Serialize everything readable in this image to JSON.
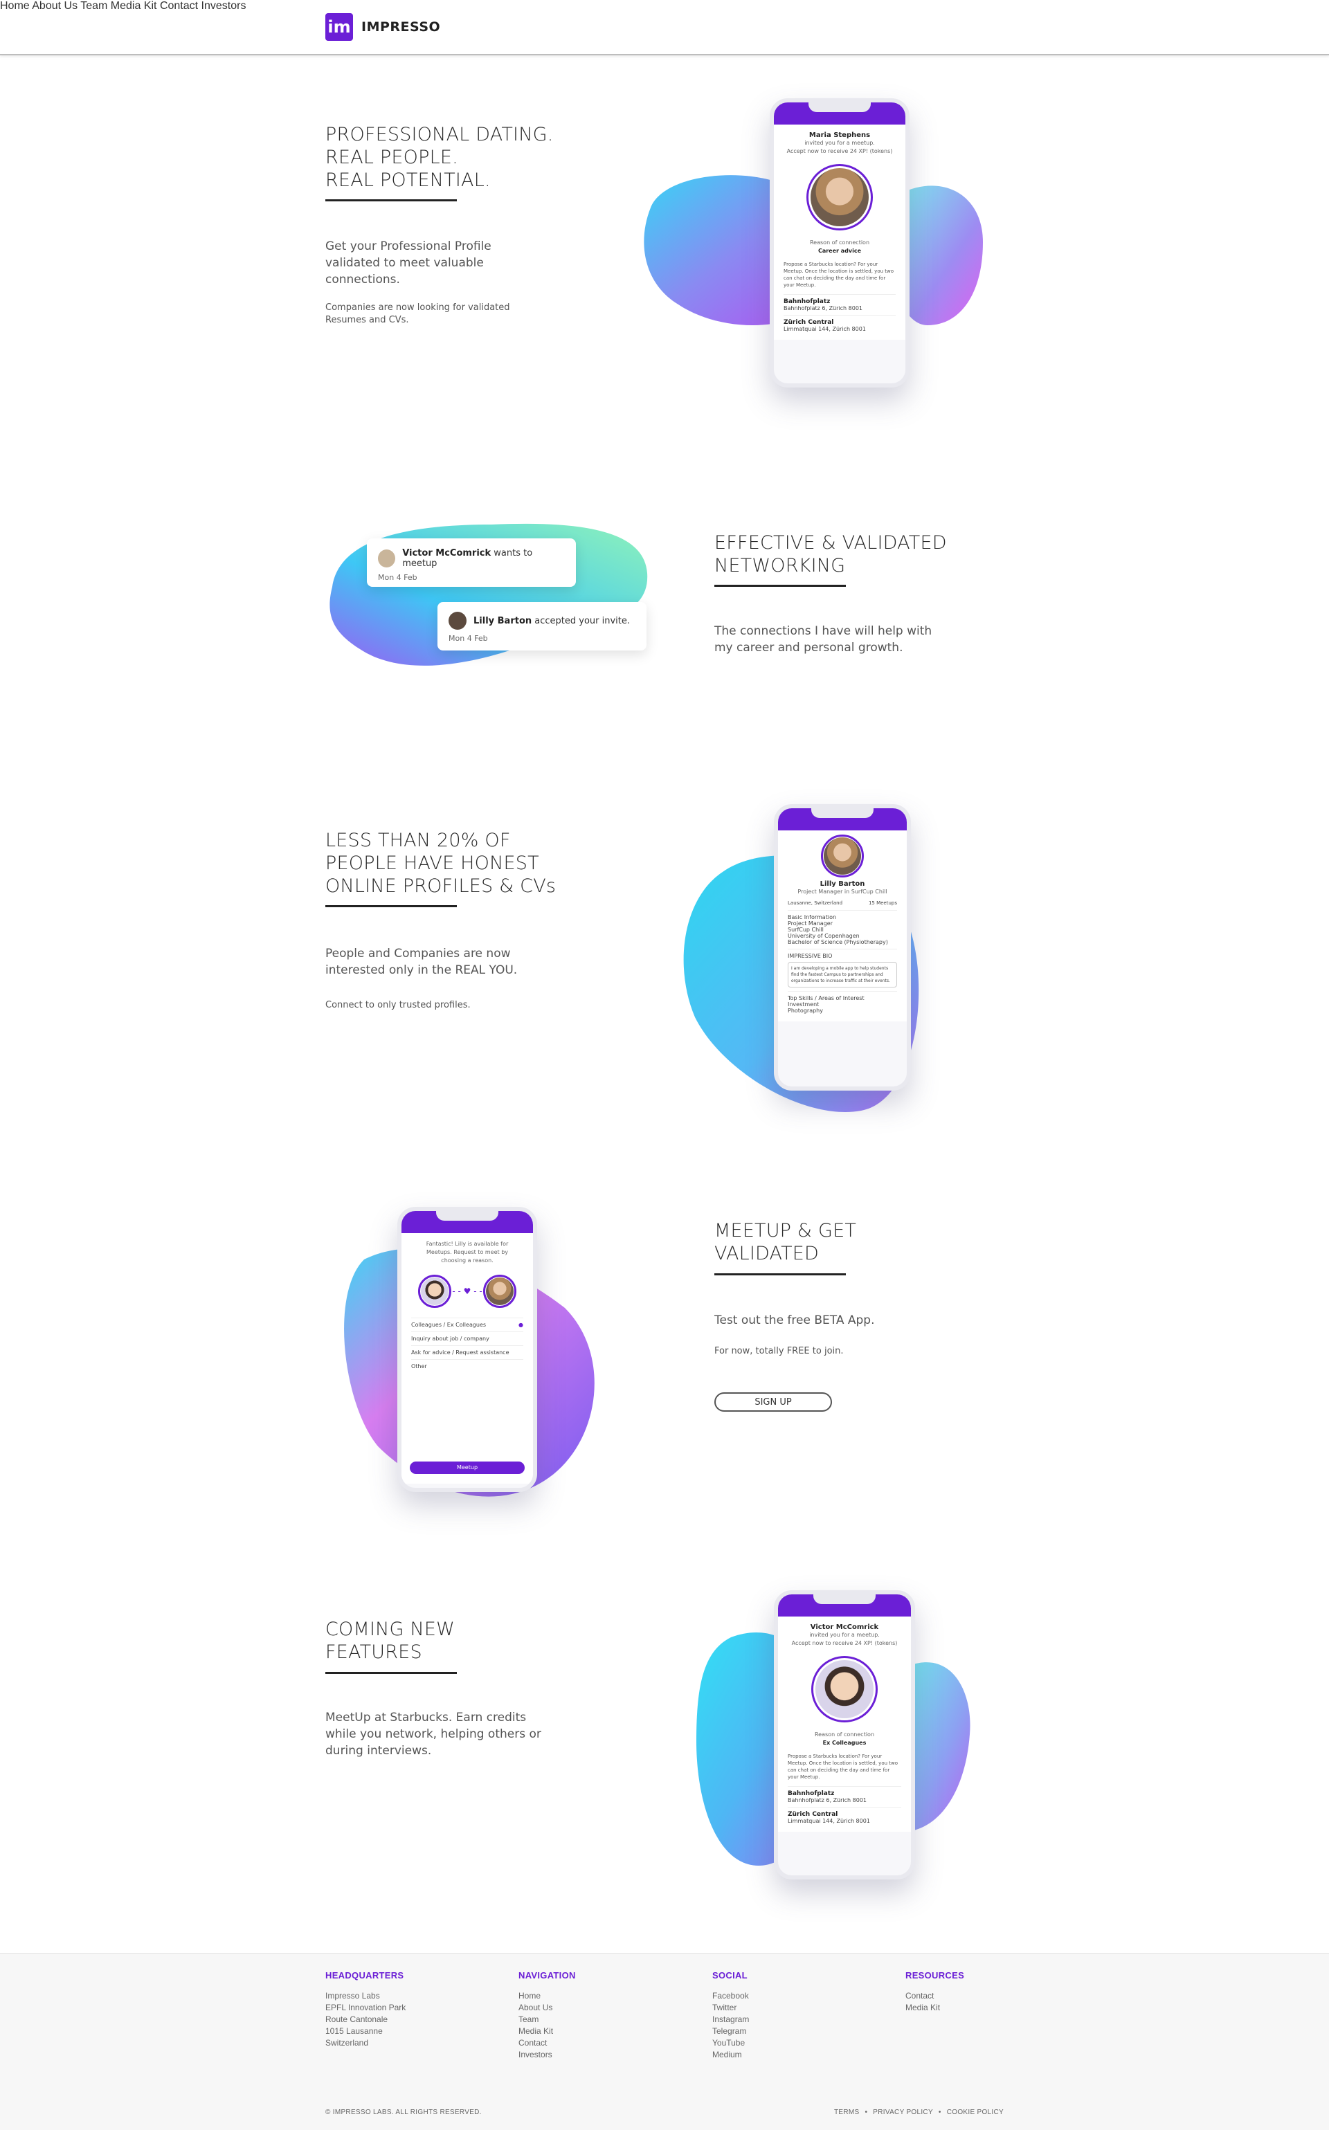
{
  "brand": {
    "logo_glyph": "im",
    "name": "IMPRESSO",
    "color": "#6b1fd6"
  },
  "nav": {
    "home": "Home",
    "about": "About Us",
    "team": "Team",
    "media": "Media Kit",
    "contact": "Contact",
    "investors": "Investors"
  },
  "s1": {
    "title1": "PROFESSIONAL DATING.",
    "title2": "REAL PEOPLE.",
    "title3": "REAL POTENTIAL.",
    "lead1": "Get your Professional Profile",
    "lead2": "validated to meet valuable",
    "lead3": "connections.",
    "small1": "Companies are now looking for validated",
    "small2": "Resumes and CVs.",
    "phone": {
      "name": "Maria Stephens",
      "invited": "invited you for a meetup.",
      "accept": "Accept now to receive 24 XP! (tokens)",
      "reason_label": "Reason of connection",
      "reason": "Career advice",
      "propose": "Propose a Starbucks location? For your Meetup. Once the location is settled, you two can chat on deciding the day and time for your Meetup.",
      "loc1": "Bahnhofplatz",
      "loc1sub": "Bahnhofplatz 6, Zürich 8001",
      "loc2": "Zürich Central",
      "loc2sub": "Limmatquai 144, Zürich 8001"
    }
  },
  "s2": {
    "title1": "EFFECTIVE & VALIDATED",
    "title2": "NETWORKING",
    "lead1": "The connections I have will help with",
    "lead2": "my career and personal growth.",
    "n1": {
      "name": "Victor McComrick",
      "text": " wants to meetup",
      "date": "Mon 4 Feb"
    },
    "n2": {
      "name": "Lilly Barton",
      "text": " accepted your invite.",
      "date": "Mon 4 Feb"
    }
  },
  "s3": {
    "title1": "LESS THAN 20% OF",
    "title2": "PEOPLE HAVE HONEST",
    "title3": "ONLINE PROFILES & CVs",
    "lead1": "People and Companies are now",
    "lead2": "interested only in the REAL YOU.",
    "small": "Connect to only trusted profiles.",
    "phone": {
      "name": "Lilly Barton",
      "role": "Project Manager in SurfCup Chill",
      "location": "Lausanne, Switzerland",
      "meetups": "15 Meetups",
      "basic": "Basic Information",
      "items": [
        "Project Manager",
        "SurfCup Chill",
        "University of Copenhagen",
        "Bachelor of Science (Physiotherapy)"
      ],
      "bio_label": "IMPRESSIVE BIO",
      "bio": "I am developing a mobile app to help students find the fastest Campus to partnerships and organizations to increase traffic at their events.",
      "skills": "Top Skills / Areas of Interest",
      "skill_items": [
        "Investment",
        "Photography"
      ]
    }
  },
  "s4": {
    "title1": "MEETUP & GET",
    "title2": "VALIDATED",
    "lead": "Test out the free BETA App.",
    "small": "For now, totally FREE to join.",
    "button": "SIGN UP",
    "phone": {
      "intro": "Fantastic! Lilly is available for Meetups. Request to meet by choosing a reason.",
      "options": [
        "Colleagues / Ex Colleagues",
        "Inquiry about job / company",
        "Ask for advice / Request assistance",
        "Other"
      ],
      "cta": "Meetup"
    }
  },
  "s5": {
    "title1": "COMING NEW",
    "title2": "FEATURES",
    "lead1": "MeetUp at Starbucks. Earn credits",
    "lead2": "while you network, helping others or",
    "lead3": "during interviews.",
    "phone": {
      "name": "Victor McComrick",
      "invited": "invited you for a meetup.",
      "accept": "Accept now to receive 24 XP! (tokens)",
      "reason_label": "Reason of connection",
      "reason": "Ex Colleagues",
      "propose": "Propose a Starbucks location? For your Meetup. Once the location is settled, you two can chat on deciding the day and time for your Meetup.",
      "loc1": "Bahnhofplatz",
      "loc1sub": "Bahnhofplatz 6, Zürich 8001",
      "loc2": "Zürich Central",
      "loc2sub": "Limmatquai 144, Zürich 8001"
    }
  },
  "footer": {
    "hq": {
      "title": "HEADQUARTERS",
      "lines": [
        "Impresso Labs",
        "EPFL Innovation Park",
        "Route Cantonale",
        "1015 Lausanne",
        "Switzerland"
      ]
    },
    "navigation": {
      "title": "NAVIGATION",
      "lines": [
        "Home",
        "About Us",
        "Team",
        "Media Kit",
        "Contact",
        "Investors"
      ]
    },
    "social": {
      "title": "SOCIAL",
      "lines": [
        "Facebook",
        "Twitter",
        "Instagram",
        "Telegram",
        "YouTube",
        "Medium"
      ]
    },
    "resources": {
      "title": "RESOURCES",
      "lines": [
        "Contact",
        "Media Kit"
      ]
    },
    "copyright": "© IMPRESSO LABS. ALL RIGHTS RESERVED.",
    "terms": "TERMS",
    "privacy": "PRIVACY POLICY",
    "cookie": "COOKIE POLICY",
    "sep": "•"
  }
}
